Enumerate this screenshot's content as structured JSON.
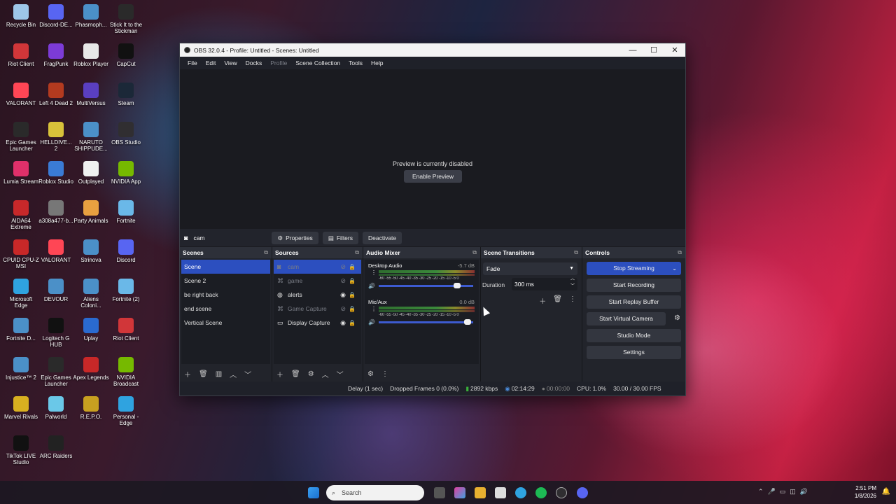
{
  "desktop_icons": [
    {
      "label": "Recycle Bin",
      "color": "#9ec6e8"
    },
    {
      "label": "Discord-DE...",
      "color": "#5865f2"
    },
    {
      "label": "Phasmoph...",
      "color": "#4b90c8"
    },
    {
      "label": "Stick It to the Stickman",
      "color": "#2a2a2a"
    },
    {
      "label": "Riot Client",
      "color": "#d13639"
    },
    {
      "label": "FragPunk",
      "color": "#7c3bd6"
    },
    {
      "label": "Roblox Player",
      "color": "#e8e8e8"
    },
    {
      "label": "CapCut",
      "color": "#111111"
    },
    {
      "label": "VALORANT",
      "color": "#ff4655"
    },
    {
      "label": "Left 4 Dead 2",
      "color": "#b33a1f"
    },
    {
      "label": "MultiVersus",
      "color": "#5a3fc0"
    },
    {
      "label": "Steam",
      "color": "#1b2838"
    },
    {
      "label": "Epic Games Launcher",
      "color": "#2a2a2a"
    },
    {
      "label": "HELLDIVE... 2",
      "color": "#d8c23a"
    },
    {
      "label": "NARUTO SHIPPUDE...",
      "color": "#4b90c8"
    },
    {
      "label": "OBS Studio",
      "color": "#302e31"
    },
    {
      "label": "Lumia Stream",
      "color": "#e0306a"
    },
    {
      "label": "Roblox Studio",
      "color": "#3a7bd5"
    },
    {
      "label": "Outplayed",
      "color": "#f0f0f0"
    },
    {
      "label": "NVIDIA App",
      "color": "#76b900"
    },
    {
      "label": "AIDA64 Extreme",
      "color": "#c8282a"
    },
    {
      "label": "a308a477-b...",
      "color": "#777777"
    },
    {
      "label": "Party Animals",
      "color": "#e8a040"
    },
    {
      "label": "Fortnite",
      "color": "#6ab8e8"
    },
    {
      "label": "CPUID CPU-Z MSI",
      "color": "#c82828"
    },
    {
      "label": "VALORANT",
      "color": "#ff4655"
    },
    {
      "label": "Strinova",
      "color": "#4b90c8"
    },
    {
      "label": "Discord",
      "color": "#5865f2"
    },
    {
      "label": "Microsoft Edge",
      "color": "#2fa3e0"
    },
    {
      "label": "DEVOUR",
      "color": "#4b90c8"
    },
    {
      "label": "Aliens Coloni...",
      "color": "#4b90c8"
    },
    {
      "label": "Fortnite (2)",
      "color": "#6ab8e8"
    },
    {
      "label": "Fortnite D...",
      "color": "#4b90c8"
    },
    {
      "label": "Logitech G HUB",
      "color": "#111111"
    },
    {
      "label": "Uplay",
      "color": "#2a6ad0"
    },
    {
      "label": "Riot Client",
      "color": "#d13639"
    },
    {
      "label": "Injustice™ 2",
      "color": "#4b90c8"
    },
    {
      "label": "Epic Games Launcher",
      "color": "#2a2a2a"
    },
    {
      "label": "Apex Legends",
      "color": "#c82828"
    },
    {
      "label": "NVIDIA Broadcast",
      "color": "#76b900"
    },
    {
      "label": "Marvel Rivals",
      "color": "#d8b020"
    },
    {
      "label": "Palworld",
      "color": "#6ac8e8"
    },
    {
      "label": "R.E.P.O.",
      "color": "#c8a020"
    },
    {
      "label": "Personal - Edge",
      "color": "#2fa3e0"
    },
    {
      "label": "TikTok LIVE Studio",
      "color": "#111111"
    },
    {
      "label": "ARC Raiders",
      "color": "#222222"
    }
  ],
  "obs": {
    "title": "OBS 32.0.4 - Profile: Untitled - Scenes: Untitled",
    "window_buttons": {
      "minimize": "—",
      "maximize": "☐",
      "close": "✕"
    },
    "menu": [
      "File",
      "Edit",
      "View",
      "Docks",
      "Profile",
      "Scene Collection",
      "Tools",
      "Help"
    ],
    "preview": {
      "message": "Preview is currently disabled",
      "button": "Enable Preview"
    },
    "source_toolbar": {
      "source": "cam",
      "properties": "Properties",
      "filters": "Filters",
      "deactivate": "Deactivate"
    },
    "scenes": {
      "title": "Scenes",
      "items": [
        "Scene",
        "Scene 2",
        "be right back",
        "end scene",
        "Vertical Scene"
      ]
    },
    "sources": {
      "title": "Sources",
      "items": [
        {
          "name": "cam",
          "icon": "camera-icon",
          "visible": false
        },
        {
          "name": "game",
          "icon": "gamepad-icon",
          "visible": false
        },
        {
          "name": "alerts",
          "icon": "globe-icon",
          "visible": true
        },
        {
          "name": "Game Capture",
          "icon": "gamepad-icon",
          "visible": false
        },
        {
          "name": "Display Capture",
          "icon": "monitor-icon",
          "visible": true
        }
      ]
    },
    "audio_mixer": {
      "title": "Audio Mixer",
      "scale": "-60 -55 -50 -45 -40 -35 -30 -25 -20 -15 -10 -5 0",
      "tracks": [
        {
          "name": "Desktop Audio",
          "db": "-5.7 dB",
          "level": 0.87
        },
        {
          "name": "Mic/Aux",
          "db": "0.0 dB",
          "level": 0.98
        }
      ]
    },
    "scene_transitions": {
      "title": "Scene Transitions",
      "transition": "Fade",
      "duration_label": "Duration",
      "duration_value": "300 ms"
    },
    "controls": {
      "title": "Controls",
      "stop_streaming": "Stop Streaming",
      "start_recording": "Start Recording",
      "start_replay_buffer": "Start Replay Buffer",
      "start_virtual_camera": "Start Virtual Camera",
      "studio_mode": "Studio Mode",
      "settings": "Settings"
    },
    "status": {
      "delay": "Delay (1 sec)",
      "dropped": "Dropped Frames 0 (0.0%)",
      "bitrate": "2892 kbps",
      "stream_time": "02:14:29",
      "record_time": "00:00:00",
      "cpu": "CPU: 1.0%",
      "fps": "30.00 / 30.00 FPS"
    }
  },
  "taskbar": {
    "search_placeholder": "Search",
    "time": "2:51 PM",
    "date": "1/8/2026"
  }
}
